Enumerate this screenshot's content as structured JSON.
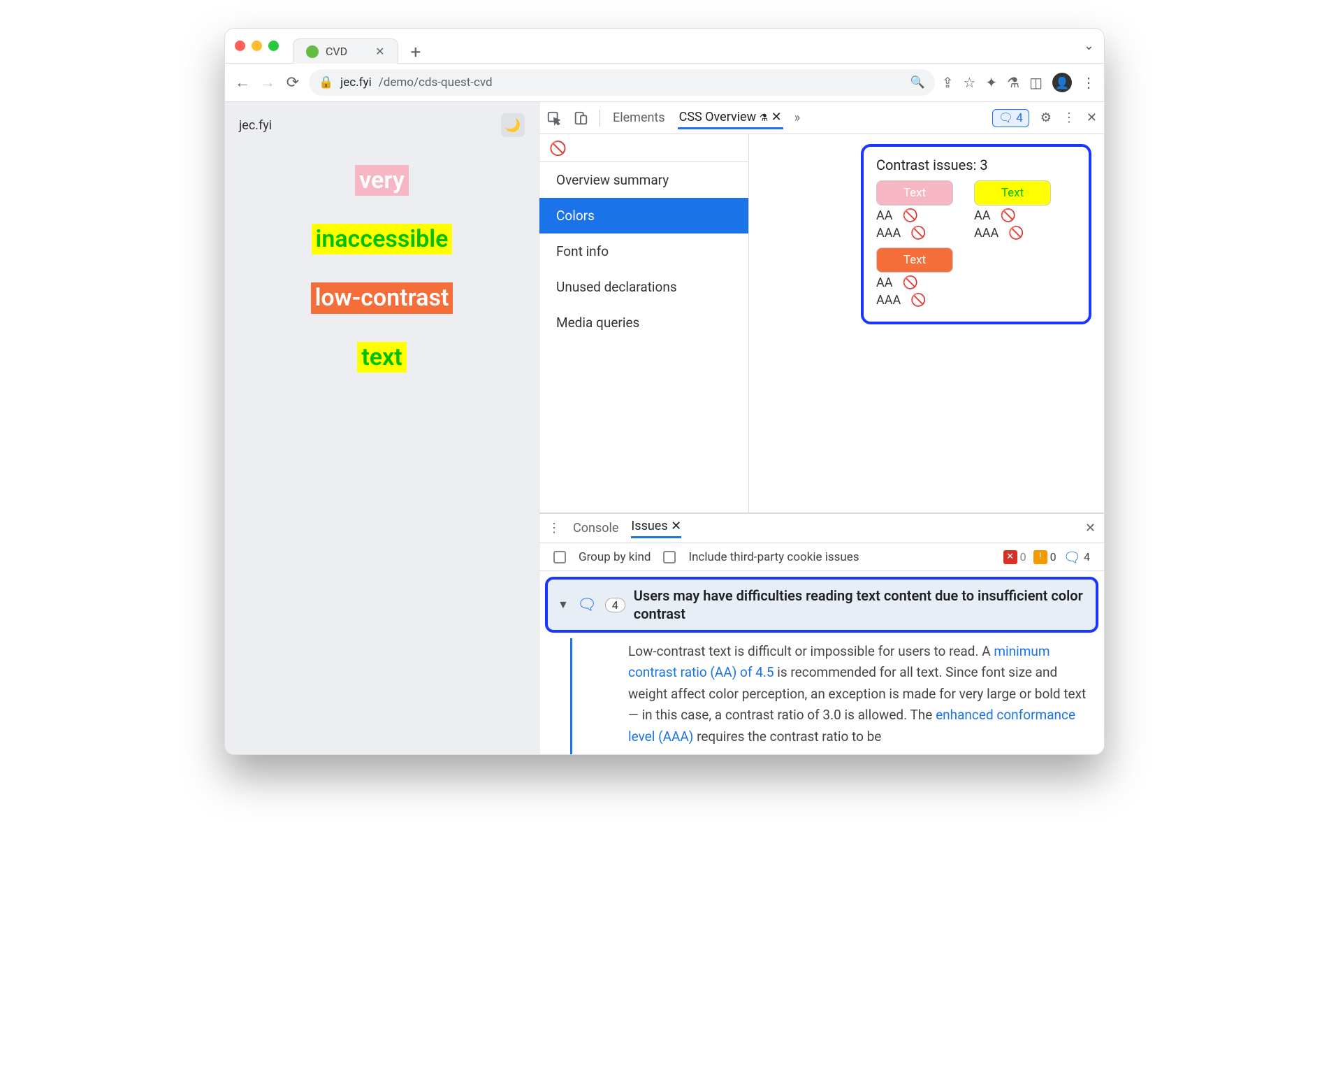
{
  "browser": {
    "tab_title": "CVD",
    "url_domain": "jec.fyi",
    "url_path": "/demo/cds-quest-cvd"
  },
  "page": {
    "site_name": "jec.fyi",
    "samples": [
      "very",
      "inaccessible",
      "low-contrast",
      "text"
    ]
  },
  "devtools": {
    "tabs": {
      "elements": "Elements",
      "css_overview": "CSS Overview"
    },
    "issue_count": "4",
    "sidebar": {
      "items": [
        "Overview summary",
        "Colors",
        "Font info",
        "Unused declarations",
        "Media queries"
      ],
      "selected": 1
    },
    "contrast": {
      "title": "Contrast issues: 3",
      "swatch_label": "Text",
      "aa": "AA",
      "aaa": "AAA"
    }
  },
  "drawer": {
    "tabs": {
      "console": "Console",
      "issues": "Issues"
    },
    "group_by_kind": "Group by kind",
    "include_third_party": "Include third-party cookie issues",
    "counts": {
      "err": "0",
      "wrn": "0",
      "inf": "4"
    },
    "issue": {
      "badge": "4",
      "title": "Users may have difficulties reading text content due to insufficient color contrast",
      "body_pre": "Low-contrast text is difficult or impossible for users to read. A ",
      "link1": "minimum contrast ratio (AA) of 4.5",
      "body_mid": " is recommended for all text. Since font size and weight affect color perception, an exception is made for very large or bold text — in this case, a contrast ratio of 3.0 is allowed. The ",
      "link2": "enhanced conformance level (AAA)",
      "body_post": " requires the contrast ratio to be"
    }
  }
}
